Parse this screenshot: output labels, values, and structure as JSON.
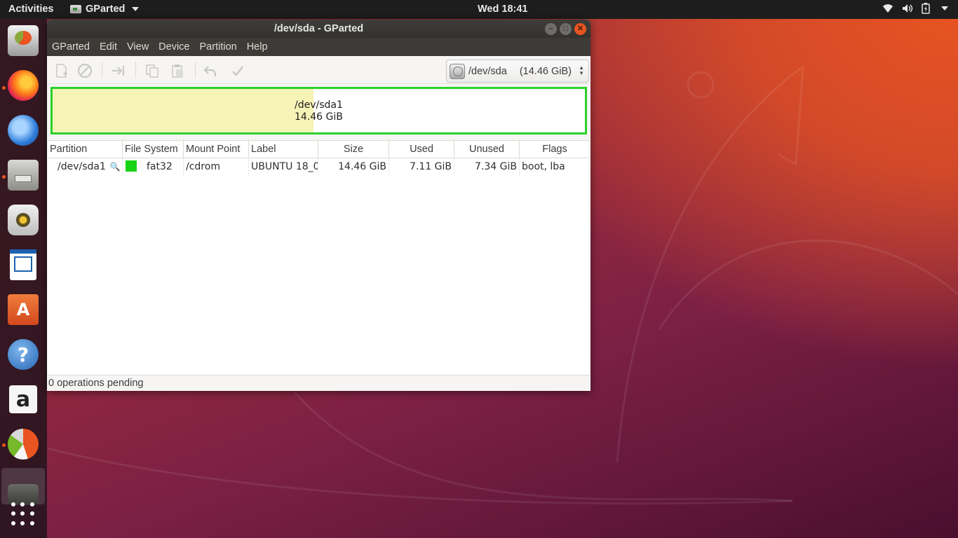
{
  "topbar": {
    "activities": "Activities",
    "app_name": "GParted",
    "clock": "Wed 18:41"
  },
  "dock": {
    "items": [
      {
        "name": "gparted-launcher-icon"
      },
      {
        "name": "firefox-icon"
      },
      {
        "name": "thunderbird-icon"
      },
      {
        "name": "files-icon"
      },
      {
        "name": "rhythmbox-icon"
      },
      {
        "name": "libreoffice-writer-icon"
      },
      {
        "name": "ubuntu-software-icon",
        "glyph": "A"
      },
      {
        "name": "help-icon",
        "glyph": "?"
      },
      {
        "name": "amazon-icon",
        "glyph": "a"
      },
      {
        "name": "chart-app-icon"
      },
      {
        "name": "gparted-running-icon"
      }
    ]
  },
  "window": {
    "title": "/dev/sda - GParted",
    "menu": [
      "GParted",
      "Edit",
      "View",
      "Device",
      "Partition",
      "Help"
    ],
    "device_selector": {
      "device": "/dev/sda",
      "size": "(14.46 GiB)"
    },
    "disk_map": {
      "partition": "/dev/sda1",
      "size": "14.46 GiB",
      "used_fraction": 0.49
    },
    "table": {
      "headers": [
        "Partition",
        "File System",
        "Mount Point",
        "Label",
        "Size",
        "Used",
        "Unused",
        "Flags"
      ],
      "rows": [
        {
          "partition": "/dev/sda1",
          "filesystem": "fat32",
          "mount_point": "/cdrom",
          "label": "UBUNTU 18_0",
          "size": "14.46 GiB",
          "used": "7.11 GiB",
          "unused": "7.34 GiB",
          "flags": "boot, lba"
        }
      ]
    },
    "status": "0 operations pending"
  },
  "colors": {
    "fat32": "#19d319",
    "accent": "#e95420",
    "selection": "#2bd12b",
    "used_space": "#f6f3b6"
  }
}
